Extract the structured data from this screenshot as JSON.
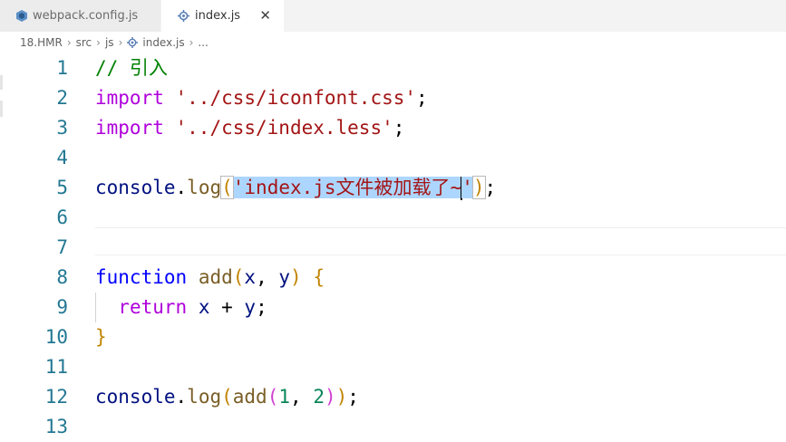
{
  "tabs": [
    {
      "label": "webpack.config.js",
      "icon": "webpack-cube-icon",
      "active": false
    },
    {
      "label": "index.js",
      "icon": "gear-file-icon",
      "active": true
    }
  ],
  "breadcrumb": {
    "items": [
      "18.HMR",
      "src",
      "js",
      "index.js",
      "..."
    ]
  },
  "lines": [
    {
      "num": "1"
    },
    {
      "num": "2"
    },
    {
      "num": "3"
    },
    {
      "num": "4"
    },
    {
      "num": "5"
    },
    {
      "num": "6"
    },
    {
      "num": "7"
    },
    {
      "num": "8"
    },
    {
      "num": "9"
    },
    {
      "num": "10"
    },
    {
      "num": "11"
    },
    {
      "num": "12"
    },
    {
      "num": "13"
    }
  ],
  "code": {
    "l1_comment": "// 引入",
    "l2_kw": "import",
    "l2_str": "'../css/iconfont.css'",
    "l2_semi": ";",
    "l3_kw": "import",
    "l3_str": "'../css/index.less'",
    "l3_semi": ";",
    "l5_obj": "console",
    "l5_dot": ".",
    "l5_fn": "log",
    "l5_open": "(",
    "l5_str": "'index.js文件被加载了~",
    "l5_quote": "'",
    "l5_close": ")",
    "l5_semi": ";",
    "l8_kw": "function",
    "l8_fn": "add",
    "l8_open": "(",
    "l8_x": "x",
    "l8_comma": ", ",
    "l8_y": "y",
    "l8_close": ")",
    "l8_brace": "{",
    "l9_kw": "return",
    "l9_x": "x",
    "l9_op": " + ",
    "l9_y": "y",
    "l9_semi": ";",
    "l10_brace": "}",
    "l12_obj": "console",
    "l12_dot": ".",
    "l12_fn": "log",
    "l12_open1": "(",
    "l12_fn2": "add",
    "l12_open2": "(",
    "l12_n1": "1",
    "l12_comma": ", ",
    "l12_n2": "2",
    "l12_close2": ")",
    "l12_close1": ")",
    "l12_semi": ";"
  },
  "colors": {
    "keyword_import": "#af00db",
    "keyword": "#0000ff",
    "string": "#a31515",
    "comment": "#008000",
    "variable": "#001080",
    "function": "#795e26",
    "number": "#098658",
    "line_number": "#237893",
    "selection": "#add6ff"
  }
}
